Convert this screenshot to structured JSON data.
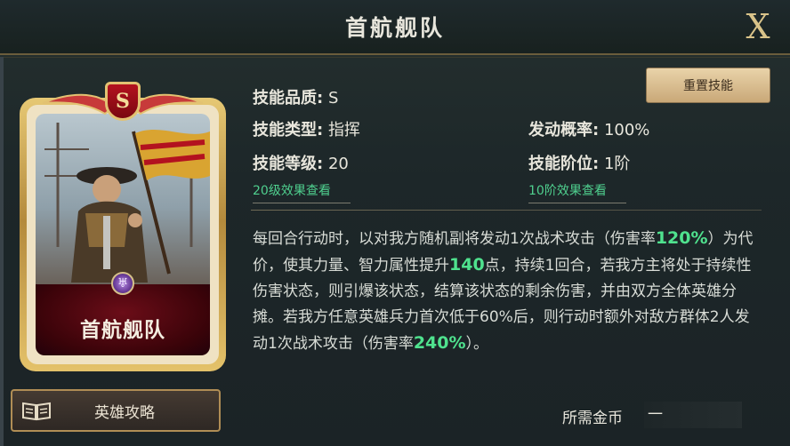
{
  "window": {
    "title": "首航舰队",
    "close_label": "X"
  },
  "card": {
    "rank": "S",
    "name": "首航舰队",
    "rank_color": "#b3121f",
    "frame_color": "#e2c272"
  },
  "guide_button": {
    "label": "英雄攻略",
    "icon": "book-icon"
  },
  "reset_button": {
    "label": "重置技能"
  },
  "stats": {
    "quality_key": "技能品质:",
    "quality_value": "S",
    "type_key": "技能类型:",
    "type_value": "指挥",
    "chance_key": "发动概率:",
    "chance_value": "100%",
    "level_key": "技能等级:",
    "level_value": "20",
    "stage_key": "技能阶位:",
    "stage_value": "1阶"
  },
  "links": {
    "level_effect": "20级效果查看",
    "stage_effect": "10阶效果查看"
  },
  "description": {
    "p1": "每回合行动时，以对我方随机副将发动1次战术攻击（伤害率",
    "h1": "120%",
    "p2": "）为代价，使其力量、智力属性提升",
    "h2": "140",
    "p3": "点，持续1回合，若我方主将处于持续性伤害状态，则引爆该状态，结算该状态的剩余伤害，并由双方全体英雄分摊。若我方任意英雄兵力首次低于60%后，则行动时额外对敌方群体2人发动1次战术攻击（伤害率",
    "h3": "240%",
    "p4": "）。"
  },
  "cost": {
    "label": "所需金币",
    "value": "一"
  },
  "colors": {
    "highlight": "#4fe28e",
    "link": "#4fcf8e",
    "accent_gold": "#d9c389"
  }
}
